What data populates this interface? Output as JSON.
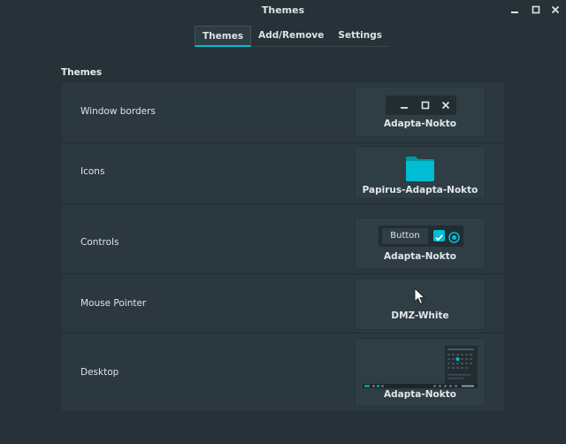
{
  "window": {
    "title": "Themes",
    "controls": [
      "minimize-icon",
      "maximize-icon",
      "close-icon"
    ]
  },
  "tabs": [
    {
      "label": "Themes",
      "active": true
    },
    {
      "label": "Add/Remove",
      "active": false
    },
    {
      "label": "Settings",
      "active": false
    }
  ],
  "section_title": "Themes",
  "rows": [
    {
      "label": "Window borders",
      "value": "Adapta-Nokto"
    },
    {
      "label": "Icons",
      "value": "Papirus-Adapta-Nokto"
    },
    {
      "label": "Controls",
      "value": "Adapta-Nokto"
    },
    {
      "label": "Mouse Pointer",
      "value": "DMZ-White"
    },
    {
      "label": "Desktop",
      "value": "Adapta-Nokto"
    }
  ],
  "controls_preview": {
    "button_label": "Button"
  },
  "colors": {
    "background": "#263238",
    "panel": "#2b383f",
    "accent": "#00bcd4"
  }
}
